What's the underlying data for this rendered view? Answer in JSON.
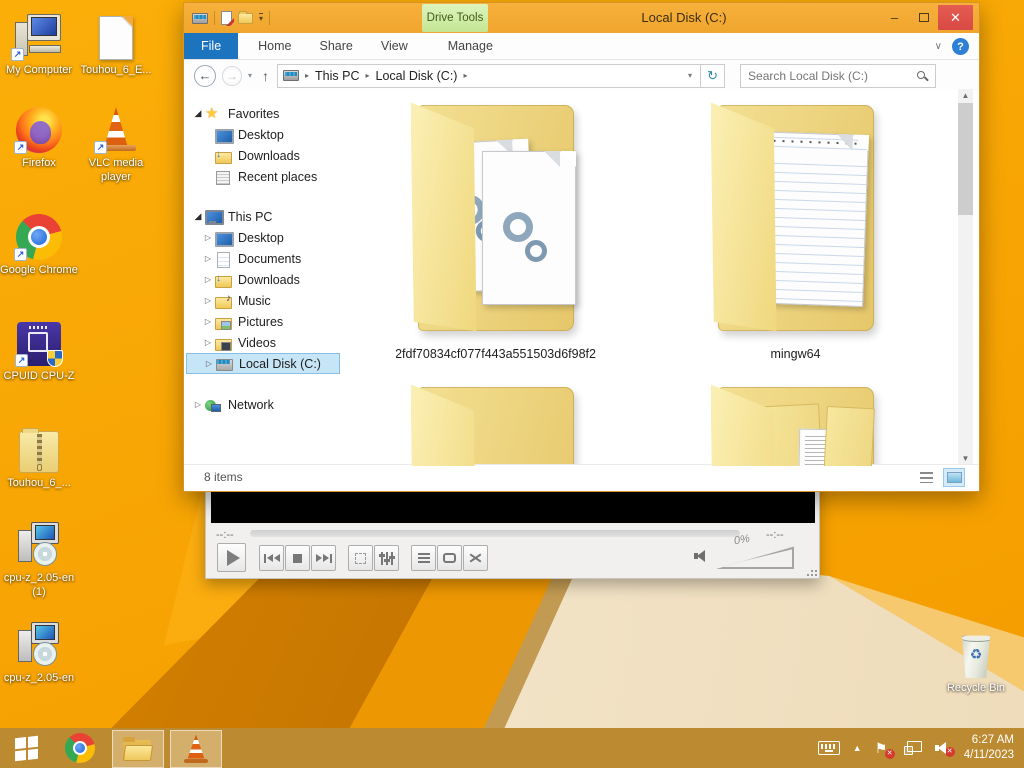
{
  "desktop": {
    "icons": [
      {
        "label": "My Computer",
        "kind": "computer"
      },
      {
        "label": "Touhou_6_E...",
        "kind": "document"
      },
      {
        "label": "Firefox",
        "kind": "firefox"
      },
      {
        "label": "VLC media player",
        "kind": "vlc"
      },
      {
        "label": "Google Chrome",
        "kind": "chrome"
      },
      {
        "label": "CPUID CPU-Z",
        "kind": "cpu-z"
      },
      {
        "label": "Touhou_6_...",
        "kind": "zip-folder"
      },
      {
        "label": "cpu-z_2.05-en (1)",
        "kind": "installer"
      },
      {
        "label": "cpu-z_2.05-en",
        "kind": "installer"
      },
      {
        "label": "Recycle Bin",
        "kind": "recycle-bin"
      }
    ]
  },
  "explorer": {
    "title": "Local Disk (C:)",
    "contextual_tab": "Drive Tools",
    "ribbon_tabs": [
      "File",
      "Home",
      "Share",
      "View",
      "Manage"
    ],
    "breadcrumb": [
      "This PC",
      "Local Disk (C:)"
    ],
    "search_placeholder": "Search Local Disk (C:)",
    "nav": {
      "sections": [
        {
          "label": "Favorites",
          "items": [
            "Desktop",
            "Downloads",
            "Recent places"
          ]
        },
        {
          "label": "This PC",
          "items": [
            "Desktop",
            "Documents",
            "Downloads",
            "Music",
            "Pictures",
            "Videos",
            "Local Disk (C:)"
          ]
        },
        {
          "label": "Network",
          "items": []
        }
      ],
      "selected": "Local Disk (C:)"
    },
    "folders": [
      {
        "name": "2fdf70834cf077f443a551503d6f98f2",
        "variant": "system-files"
      },
      {
        "name": "mingw64",
        "variant": "text-document"
      },
      {
        "name": "",
        "variant": "empty"
      },
      {
        "name": "",
        "variant": "documents"
      }
    ],
    "status_text": "8 items"
  },
  "vlc": {
    "elapsed": "--:--",
    "total": "--:--",
    "volume_label": "0%"
  },
  "taskbar": {
    "time": "6:27 AM",
    "date": "4/11/2023"
  },
  "colors": {
    "accent_blue": "#1C74BF",
    "drive_tools_green": "#CDE9A3",
    "close_red": "#D84943",
    "desktop_orange": "#F8A300",
    "taskbar_amber": "#BC8A31",
    "selection_blue": "#C6E5F7"
  }
}
